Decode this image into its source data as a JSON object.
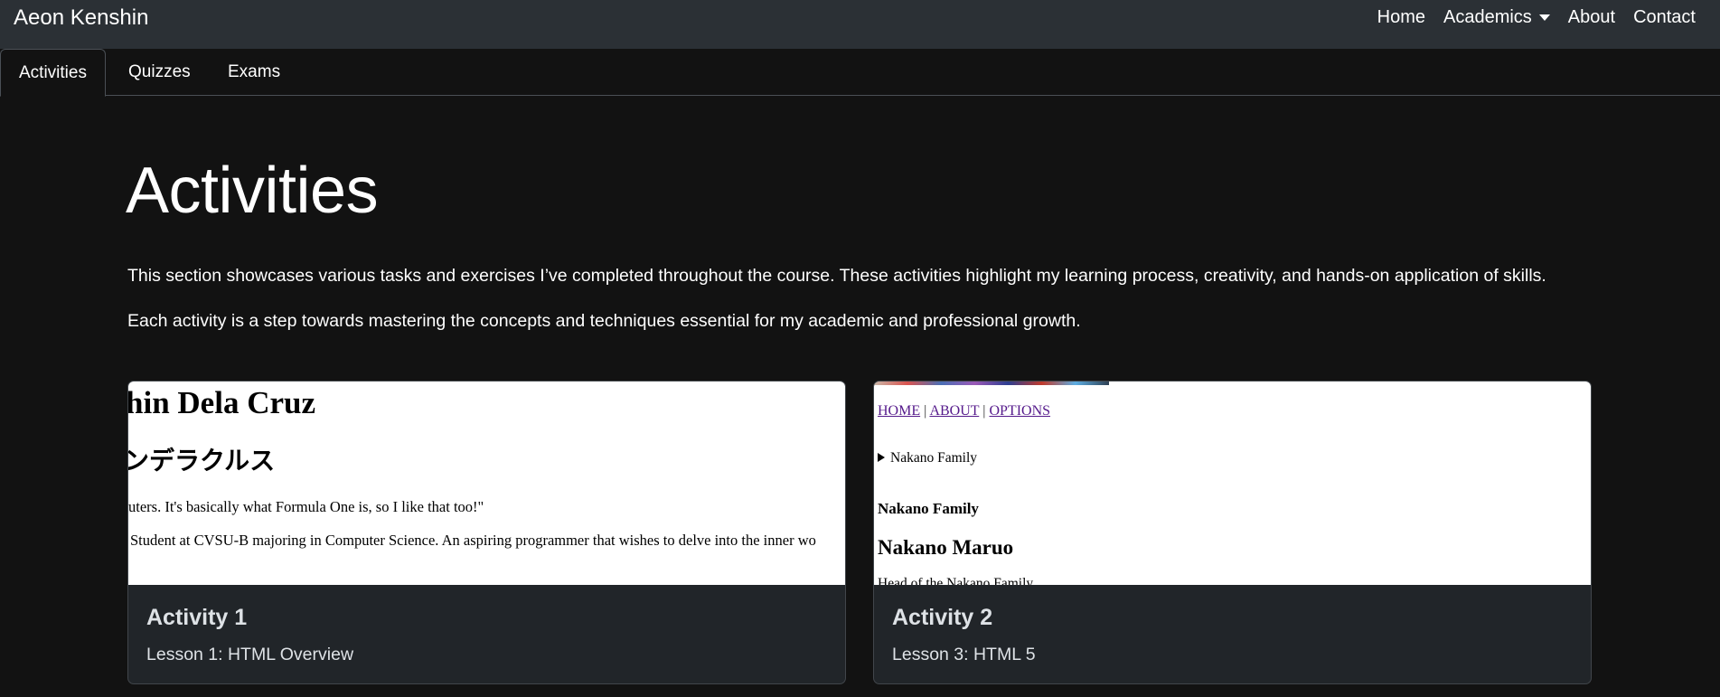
{
  "navbar": {
    "brand": "Aeon Kenshin",
    "links": {
      "home": "Home",
      "academics": "Academics",
      "about": "About",
      "contact": "Contact"
    }
  },
  "tabs": [
    {
      "label": "Activities",
      "active": true
    },
    {
      "label": "Quizzes",
      "active": false
    },
    {
      "label": "Exams",
      "active": false
    }
  ],
  "main": {
    "title": "Activities",
    "paragraph1": "This section showcases various tasks and exercises I’ve completed throughout the course. These activities highlight my learning process, creativity, and hands-on application of skills.",
    "paragraph2": "Each activity is a step towards mastering the concepts and techniques essential for my academic and professional growth."
  },
  "cards": [
    {
      "title": "Activity 1",
      "text": "Lesson 1: HTML Overview",
      "preview": {
        "heading": "hin Dela Cruz",
        "subheading": "ンデラクルス",
        "line1": "uters. It's basically what Formula One is, so I like that too!\"",
        "line2": "Student at CVSU-B majoring in Computer Science. An aspiring programmer that wishes to delve into the inner wo"
      }
    },
    {
      "title": "Activity 2",
      "text": "Lesson 3: HTML 5",
      "preview": {
        "nav_home": "HOME",
        "nav_about": "ABOUT",
        "nav_options": "OPTIONS",
        "nav_sep": "|",
        "details": "Nakano Family",
        "heading_small": "Nakano Family",
        "heading_large": "Nakano Maruo",
        "cut_line": "Head of the Nakano Family"
      }
    }
  ],
  "colors": {
    "navbar_bg": "#2b3035",
    "page_bg": "#121212",
    "card_bg": "#212529",
    "link_visited": "#551a8b"
  }
}
